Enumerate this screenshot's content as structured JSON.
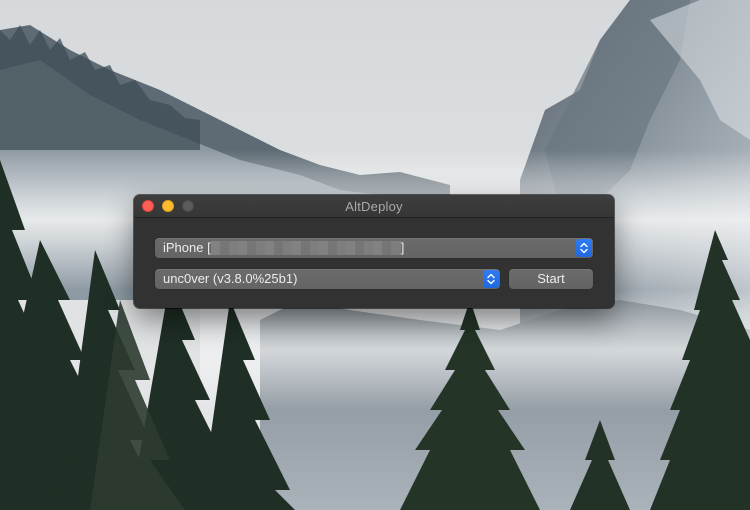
{
  "window": {
    "title": "AltDeploy"
  },
  "device_select": {
    "prefix": "iPhone [",
    "suffix": "]",
    "icon": "up-down-chevron-icon"
  },
  "app_select": {
    "value": "unc0ver (v3.8.0%25b1)",
    "icon": "up-down-chevron-icon"
  },
  "start_button": {
    "label": "Start"
  },
  "colors": {
    "close": "#fe5f57",
    "minimize": "#febc2e",
    "zoom_inactive": "#5b5b5b",
    "accent": "#2f7cf6"
  }
}
